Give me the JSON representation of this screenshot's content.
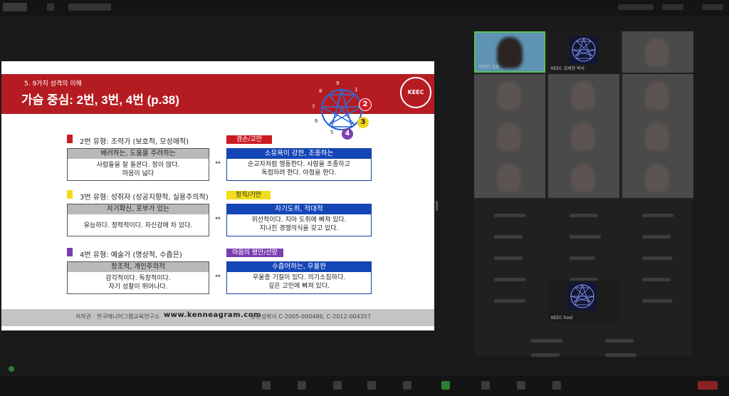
{
  "slide": {
    "subtitle": "5. 9가지 성격의 이해",
    "title": "가슴 중심: 2번, 3번, 4번 (p.38)",
    "logo_text": "KEEC",
    "enneagram_numbers": [
      "9",
      "1",
      "2",
      "3",
      "4",
      "5",
      "6",
      "7",
      "8"
    ],
    "badges": [
      {
        "num": "2",
        "color": "#d0202a"
      },
      {
        "num": "3",
        "color": "#f2d21a"
      },
      {
        "num": "4",
        "color": "#7b3fb0"
      }
    ],
    "types": [
      {
        "heading": "2번 유형: 조력가 (보호적, 모성애적)",
        "color": "#cc1b22",
        "tag": "겸손/교만",
        "tag_bg": "#cc1b22",
        "tag_fg": "#ffffff",
        "left_head": "배려하는, 도움을 주려하는",
        "left_lines": [
          "사람들을 잘 돌본다. 정이 많다.",
          "마음이 넓다"
        ],
        "right_head": "소유욕이 강한, 조종하는",
        "right_lines": [
          "순교자처럼 행동한다. 사람을 조종하고",
          "독점하려 한다. 아첨을 한다."
        ]
      },
      {
        "heading": "3번 유형: 성취자 (성공지향적, 실용주의적)",
        "color": "#f2dc1c",
        "tag": "정직/기만",
        "tag_bg": "#f2dc1c",
        "tag_fg": "#222222",
        "left_head": "자기확신, 포부가 있는",
        "left_lines": [
          "유능하다. 정력적이다. 자신감에 차 있다."
        ],
        "right_head": "자기도취, 적대적",
        "right_lines": [
          "위선적이다. 지아 도취에 빠져 있다.",
          "지나친 경쟁의식을 갖고 있다."
        ]
      },
      {
        "heading": "4번 유형: 예술가 (명상적, 수줍은)",
        "color": "#7b3fb0",
        "tag": "마음의 평안/선망",
        "tag_bg": "#7b3fb0",
        "tag_fg": "#ffffff",
        "left_head": "창조적, 개인주의적",
        "left_lines": [
          "감각적이다. 독창적이다.",
          "자기 성찰이 뛰어나다."
        ],
        "right_head": "수줍어하는, 우울한",
        "right_lines": [
          "우울증 기질이 있다. 의기소침하다.",
          "깊은 고민에 빠져 있다."
        ]
      }
    ],
    "footer": {
      "author": "저작권 : 한국에니어그램교육연구소",
      "url": "www.kenneagram.com",
      "copyright": "윤운성박사 C-2005-000486, C-2012-004357"
    }
  },
  "gallery": {
    "tiles": [
      {
        "name": "지현진 교수",
        "kind": "active"
      },
      {
        "name": "KEEC 김세현 박사",
        "kind": "logo"
      },
      {
        "name": "",
        "kind": "video"
      },
      {
        "name": "",
        "kind": "video"
      },
      {
        "name": "",
        "kind": "video"
      },
      {
        "name": "",
        "kind": "video"
      },
      {
        "name": "",
        "kind": "video"
      },
      {
        "name": "",
        "kind": "video"
      },
      {
        "name": "",
        "kind": "video"
      },
      {
        "name": "",
        "kind": "video"
      },
      {
        "name": "",
        "kind": "video"
      },
      {
        "name": "",
        "kind": "video"
      }
    ],
    "host_tile": {
      "name": "KEEC host",
      "logo_text": "KEEC"
    }
  },
  "arrow_glyph": "↔"
}
